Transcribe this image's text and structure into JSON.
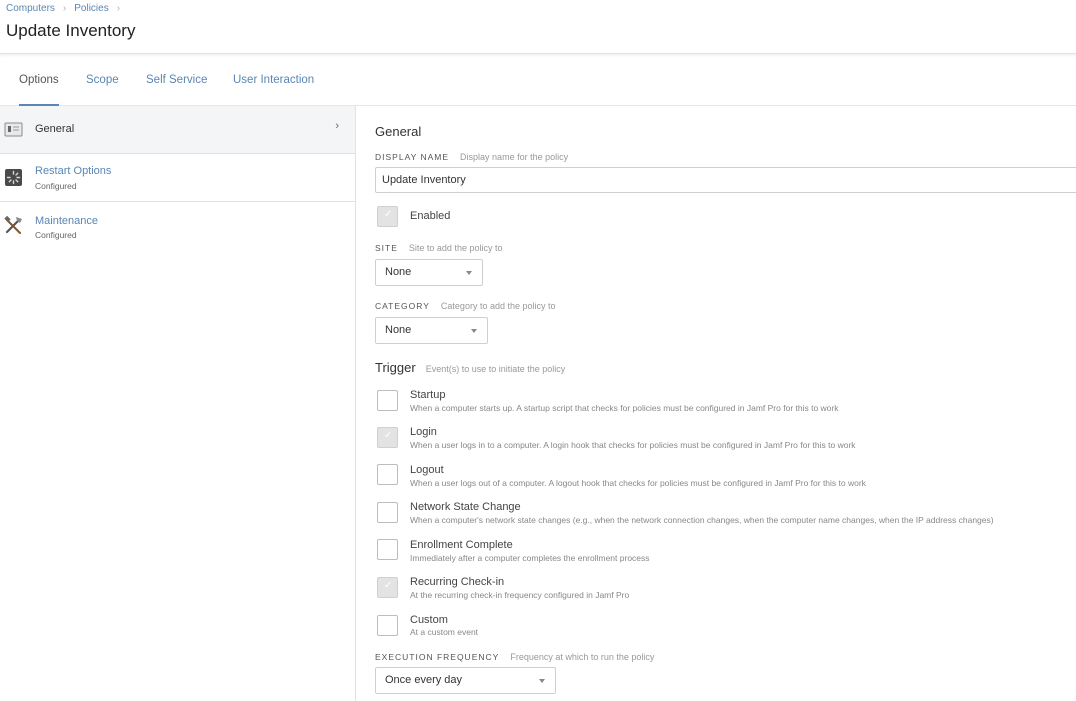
{
  "breadcrumb": {
    "items": [
      "Computers",
      "Policies"
    ],
    "separator": "›"
  },
  "page": {
    "title": "Update Inventory"
  },
  "tabs": [
    {
      "label": "Options",
      "active": true
    },
    {
      "label": "Scope",
      "active": false
    },
    {
      "label": "Self Service",
      "active": false
    },
    {
      "label": "User Interaction",
      "active": false
    }
  ],
  "sidebar": {
    "items": [
      {
        "label": "General",
        "sub": "",
        "icon": "general-icon",
        "active": true
      },
      {
        "label": "Restart Options",
        "sub": "Configured",
        "icon": "restart-icon",
        "active": false
      },
      {
        "label": "Maintenance",
        "sub": "Configured",
        "icon": "tools-icon",
        "active": false
      }
    ],
    "chevron": "›"
  },
  "general": {
    "section_title": "General",
    "display_name": {
      "label": "Display Name",
      "hint": "Display name for the policy",
      "value": "Update Inventory"
    },
    "enabled": {
      "label": "Enabled",
      "checked": true
    },
    "site": {
      "label": "Site",
      "hint": "Site to add the policy to",
      "value": "None"
    },
    "category": {
      "label": "Category",
      "hint": "Category to add the policy to",
      "value": "None"
    }
  },
  "trigger": {
    "title": "Trigger",
    "hint": "Event(s) to use to initiate the policy",
    "items": [
      {
        "label": "Startup",
        "desc": "When a computer starts up. A startup script that checks for policies must be configured in Jamf Pro for this to work",
        "checked": false
      },
      {
        "label": "Login",
        "desc": "When a user logs in to a computer. A login hook that checks for policies must be configured in Jamf Pro for this to work",
        "checked": true
      },
      {
        "label": "Logout",
        "desc": "When a user logs out of a computer. A logout hook that checks for policies must be configured in Jamf Pro for this to work",
        "checked": false
      },
      {
        "label": "Network State Change",
        "desc": "When a computer's network state changes (e.g., when the network connection changes, when the computer name changes, when the IP address changes)",
        "checked": false
      },
      {
        "label": "Enrollment Complete",
        "desc": "Immediately after a computer completes the enrollment process",
        "checked": false
      },
      {
        "label": "Recurring Check-in",
        "desc": "At the recurring check-in frequency configured in Jamf Pro",
        "checked": true
      },
      {
        "label": "Custom",
        "desc": "At a custom event",
        "checked": false
      }
    ]
  },
  "execution_frequency": {
    "label": "Execution Frequency",
    "hint": "Frequency at which to run the policy",
    "value": "Once every day"
  },
  "colors": {
    "link": "#5a86b4",
    "active_tab_underline": "#5a86b4",
    "sidebar_active_bg": "#f4f5f7"
  }
}
